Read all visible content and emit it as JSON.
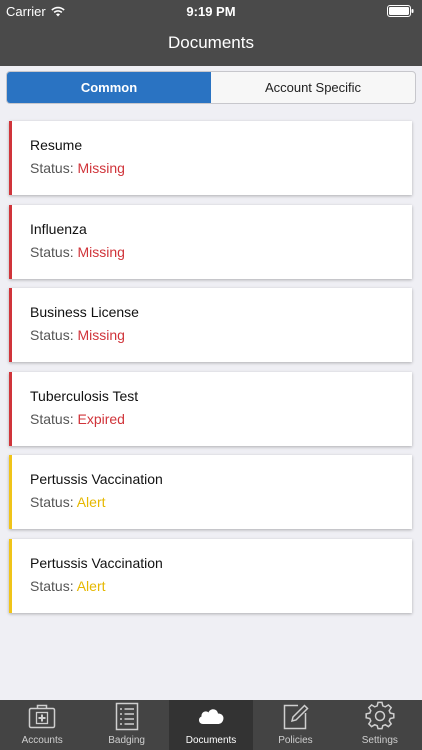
{
  "status_bar": {
    "carrier": "Carrier",
    "time": "9:19 PM"
  },
  "nav": {
    "title": "Documents"
  },
  "segments": [
    {
      "label": "Common",
      "active": true
    },
    {
      "label": "Account Specific",
      "active": false
    }
  ],
  "status_prefix": "Status:",
  "documents": [
    {
      "title": "Resume",
      "status": "Missing",
      "level": "missing"
    },
    {
      "title": "Influenza",
      "status": "Missing",
      "level": "missing"
    },
    {
      "title": "Business License",
      "status": "Missing",
      "level": "missing"
    },
    {
      "title": "Tuberculosis Test",
      "status": "Expired",
      "level": "expired"
    },
    {
      "title": "Pertussis Vaccination",
      "status": "Alert",
      "level": "alert"
    },
    {
      "title": "Pertussis Vaccination",
      "status": "Alert",
      "level": "alert"
    }
  ],
  "tabs": [
    {
      "label": "Accounts",
      "icon": "medical-kit-icon",
      "active": false
    },
    {
      "label": "Badging",
      "icon": "checklist-icon",
      "active": false
    },
    {
      "label": "Documents",
      "icon": "cloud-icon",
      "active": true
    },
    {
      "label": "Policies",
      "icon": "edit-icon",
      "active": false
    },
    {
      "label": "Settings",
      "icon": "gear-icon",
      "active": false
    }
  ],
  "colors": {
    "header_bg": "#4a4a4a",
    "accent_blue": "#2a73c2",
    "missing_red": "#d0343a",
    "alert_yellow": "#f0c419",
    "tabbar_bg": "#444444"
  }
}
